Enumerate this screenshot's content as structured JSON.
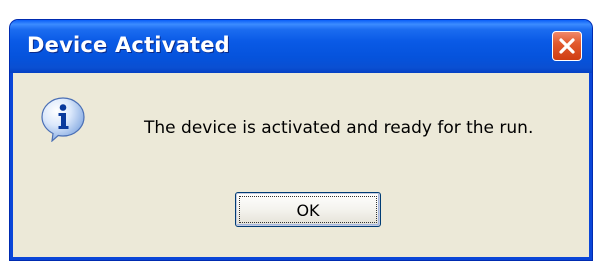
{
  "window": {
    "title": "Device Activated",
    "close_icon": "close-icon"
  },
  "dialog": {
    "icon": "info-icon",
    "message": "The device is activated and ready for the run.",
    "ok_label": "OK"
  },
  "colors": {
    "titlebar": "#0a5ae6",
    "dialog_bg": "#ece9d8",
    "close_button": "#e25a2e",
    "border": "#0a46d8"
  }
}
